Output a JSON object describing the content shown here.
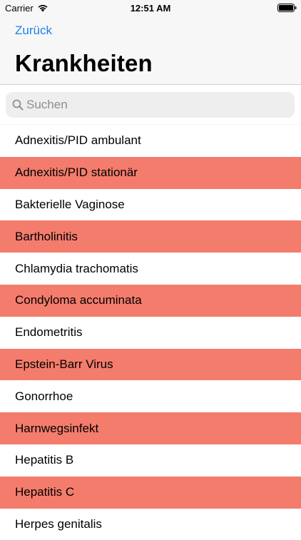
{
  "status_bar": {
    "carrier": "Carrier",
    "time": "12:51 AM"
  },
  "nav": {
    "back_label": "Zurück",
    "title": "Krankheiten"
  },
  "search": {
    "placeholder": "Suchen",
    "icon": "magnifying-glass"
  },
  "colors": {
    "accent": "#1a82e8",
    "highlight_row": "#f47c6c"
  },
  "diseases": [
    {
      "label": "Adnexitis/PID ambulant",
      "highlighted": false
    },
    {
      "label": "Adnexitis/PID stationär",
      "highlighted": true
    },
    {
      "label": "Bakterielle Vaginose",
      "highlighted": false
    },
    {
      "label": "Bartholinitis",
      "highlighted": true
    },
    {
      "label": "Chlamydia trachomatis",
      "highlighted": false
    },
    {
      "label": "Condyloma accuminata",
      "highlighted": true
    },
    {
      "label": "Endometritis",
      "highlighted": false
    },
    {
      "label": "Epstein-Barr Virus",
      "highlighted": true
    },
    {
      "label": "Gonorrhoe",
      "highlighted": false
    },
    {
      "label": "Harnwegsinfekt",
      "highlighted": true
    },
    {
      "label": "Hepatitis B",
      "highlighted": false
    },
    {
      "label": "Hepatitis C",
      "highlighted": true
    },
    {
      "label": "Herpes genitalis",
      "highlighted": false
    }
  ]
}
